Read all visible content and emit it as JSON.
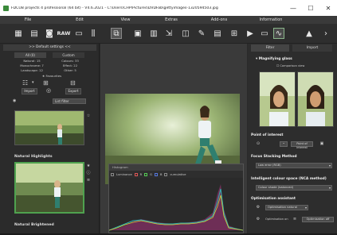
{
  "window": {
    "title": "FDCUB projects 4 professional (64 bit) - V4.6.2021 - C:\\Users\\CHP\\Pictures\\DVDFab\\gettyimages-1320594503.jpg",
    "minimize": "—",
    "maximize": "☐",
    "close": "✕"
  },
  "menu": [
    "File",
    "Edit",
    "View",
    "Extras",
    "Add-ons",
    "Information"
  ],
  "toolbar": {
    "raw_label": "RAW"
  },
  "left": {
    "header": ">> Default settings <<",
    "tabs": [
      "All (0)",
      "Custom"
    ],
    "counts_left": [
      "Natural: 15",
      "Monochrome: 7",
      "Landscape: 12"
    ],
    "counts_right": [
      "Colours: 33",
      "Effect: 22",
      "Other: 5"
    ],
    "favourites": "Favourites",
    "import_label": "Import",
    "export_label": "Export",
    "combo_value": "List filter",
    "presets": [
      "Natural Highlights",
      "Natural Brightened"
    ]
  },
  "center": {
    "histogram": {
      "header": "Histogram",
      "checks": [
        "Luminance",
        "R",
        "G",
        "B",
        "cumulative"
      ]
    }
  },
  "right": {
    "tabs": [
      "Filter",
      "Import"
    ],
    "sections": {
      "magnifier": "Magnifying glass",
      "magnifier_opt": "Comparison view",
      "interest": "Point of interest",
      "interest_btn": "Point of interest",
      "focus": "Focus Stacking Method",
      "focus_value": "Low error (RGB)",
      "colour": "Intelligent colour space (NCA method)",
      "colour_value": "Colour shade (balanced)",
      "optimisation": "Optimisation assistant",
      "optimisation_value": "Optimisation natural",
      "opt_on": "Optimisation on",
      "opt_off": "Optimisation off"
    }
  },
  "colors": {
    "accent_green": "#4fa24f",
    "panel": "#2d2d2d"
  }
}
